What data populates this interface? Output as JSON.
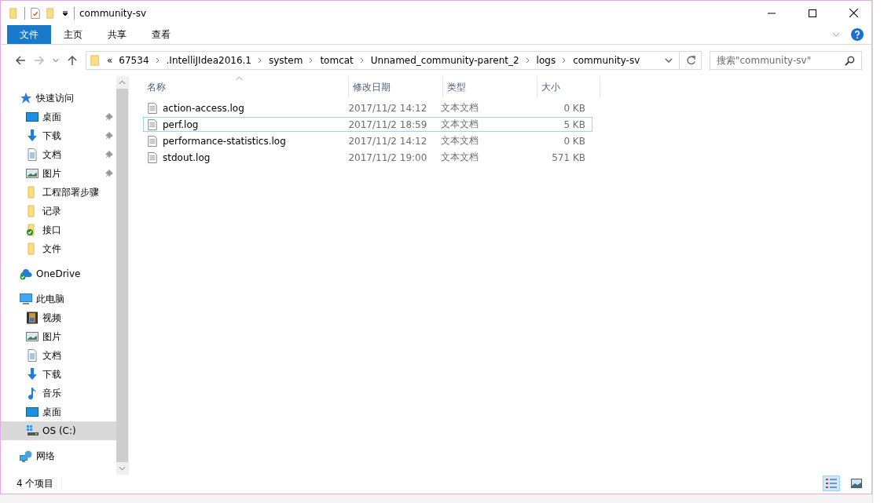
{
  "window": {
    "title": "community-sv"
  },
  "ribbon_tabs": [
    {
      "label": "文件",
      "selected": true
    },
    {
      "label": "主页",
      "selected": false
    },
    {
      "label": "共享",
      "selected": false
    },
    {
      "label": "查看",
      "selected": false
    }
  ],
  "address": {
    "overflow": "«",
    "segments": [
      "67534",
      ".IntelliJIdea2016.1",
      "system",
      "tomcat",
      "Unnamed_community-parent_2",
      "logs",
      "community-sv"
    ]
  },
  "search": {
    "placeholder": "搜索\"community-sv\""
  },
  "sidebar": {
    "items": [
      {
        "label": "快速访问",
        "kind": "star",
        "pinned": false,
        "selected": false,
        "children": [
          {
            "label": "桌面",
            "kind": "desktop",
            "pinned": true,
            "selected": false
          },
          {
            "label": "下载",
            "kind": "download",
            "pinned": true,
            "selected": false
          },
          {
            "label": "文档",
            "kind": "document",
            "pinned": true,
            "selected": false
          },
          {
            "label": "图片",
            "kind": "picture",
            "pinned": true,
            "selected": false
          },
          {
            "label": "工程部署步骤",
            "kind": "folder",
            "pinned": false,
            "selected": false
          },
          {
            "label": "记录",
            "kind": "folder",
            "pinned": false,
            "selected": false
          },
          {
            "label": "接口",
            "kind": "synced-folder",
            "pinned": false,
            "selected": false
          },
          {
            "label": "文件",
            "kind": "folder",
            "pinned": false,
            "selected": false
          }
        ]
      },
      {
        "label": "OneDrive",
        "kind": "cloud",
        "pinned": false,
        "selected": false
      },
      {
        "label": "此电脑",
        "kind": "pc",
        "pinned": false,
        "selected": false,
        "children": [
          {
            "label": "视频",
            "kind": "video",
            "pinned": false,
            "selected": false
          },
          {
            "label": "图片",
            "kind": "picture",
            "pinned": false,
            "selected": false
          },
          {
            "label": "文档",
            "kind": "document",
            "pinned": false,
            "selected": false
          },
          {
            "label": "下载",
            "kind": "download",
            "pinned": false,
            "selected": false
          },
          {
            "label": "音乐",
            "kind": "music",
            "pinned": false,
            "selected": false
          },
          {
            "label": "桌面",
            "kind": "desktop",
            "pinned": false,
            "selected": false
          },
          {
            "label": "OS (C:)",
            "kind": "drive",
            "pinned": false,
            "selected": true
          }
        ]
      },
      {
        "label": "网络",
        "kind": "network",
        "pinned": false,
        "selected": false
      }
    ]
  },
  "table": {
    "columns": [
      {
        "label": "名称",
        "sorted": true
      },
      {
        "label": "修改日期",
        "sorted": false
      },
      {
        "label": "类型",
        "sorted": false
      },
      {
        "label": "大小",
        "sorted": false
      }
    ],
    "rows": [
      {
        "name": "action-access.log",
        "date": "2017/11/2 14:12",
        "type": "文本文档",
        "size": "0 KB",
        "focused": false
      },
      {
        "name": "perf.log",
        "date": "2017/11/2 18:59",
        "type": "文本文档",
        "size": "5 KB",
        "focused": true
      },
      {
        "name": "performance-statistics.log",
        "date": "2017/11/2 14:12",
        "type": "文本文档",
        "size": "0 KB",
        "focused": false
      },
      {
        "name": "stdout.log",
        "date": "2017/11/2 19:00",
        "type": "文本文档",
        "size": "571 KB",
        "focused": false
      }
    ]
  },
  "status_bar": {
    "count": "4 个项目",
    "views": [
      {
        "kind": "details",
        "selected": true
      },
      {
        "kind": "thumbnails",
        "selected": false
      }
    ]
  }
}
